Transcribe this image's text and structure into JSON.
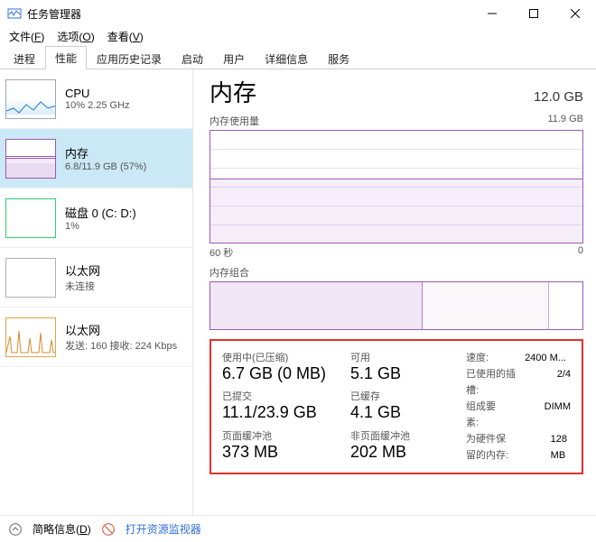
{
  "window": {
    "title": "任务管理器"
  },
  "menu": {
    "file": "文件",
    "file_mn": "F",
    "options": "选项",
    "options_mn": "O",
    "view": "查看",
    "view_mn": "V"
  },
  "tabs": {
    "processes": "进程",
    "performance": "性能",
    "app_history": "应用历史记录",
    "startup": "启动",
    "users": "用户",
    "details": "详细信息",
    "services": "服务"
  },
  "sidebar": {
    "cpu": {
      "title": "CPU",
      "sub": "10% 2.25 GHz"
    },
    "memory": {
      "title": "内存",
      "sub": "6.8/11.9 GB (57%)"
    },
    "disk": {
      "title": "磁盘 0 (C: D:)",
      "sub": "1%"
    },
    "eth1": {
      "title": "以太网",
      "sub": "未连接"
    },
    "eth2": {
      "title": "以太网",
      "sub": "发送: 160 接收: 224 Kbps"
    }
  },
  "main": {
    "title": "内存",
    "total": "12.0 GB",
    "usage_label": "内存使用量",
    "usage_max": "11.9 GB",
    "x_left": "60 秒",
    "x_right": "0",
    "comp_label": "内存组合"
  },
  "stats": {
    "in_use_label": "使用中(已压缩)",
    "in_use_value": "6.7 GB (0 MB)",
    "available_label": "可用",
    "available_value": "5.1 GB",
    "committed_label": "已提交",
    "committed_value": "11.1/23.9 GB",
    "cached_label": "已缓存",
    "cached_value": "4.1 GB",
    "paged_label": "页面缓冲池",
    "paged_value": "373 MB",
    "nonpaged_label": "非页面缓冲池",
    "nonpaged_value": "202 MB"
  },
  "side_stats": {
    "speed_label": "速度:",
    "speed_value": "2400 M...",
    "slots_label": "已使用的插槽:",
    "slots_value": "2/4",
    "form_label": "组成要素:",
    "form_value": "DIMM",
    "reserved_label": "为硬件保留的内存:",
    "reserved_value": "128 MB"
  },
  "footer": {
    "brief": "简略信息",
    "brief_mn": "D",
    "open_resmon": "打开资源监视器"
  }
}
